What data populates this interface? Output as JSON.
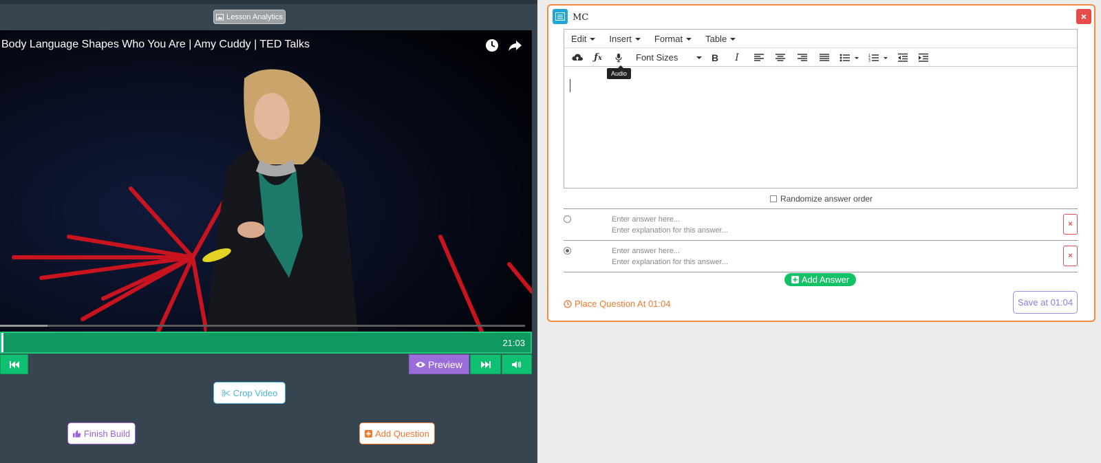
{
  "left": {
    "analytics_label": "Lesson Analytics",
    "video": {
      "title": "Body Language Shapes Who You Are | Amy Cuddy | TED Talks",
      "progress_loaded_fraction": 0.09
    },
    "timeline": {
      "time": "21:03"
    },
    "controls": {
      "preview_label": "Preview"
    },
    "crop_label": "Crop Video",
    "finish_label": "Finish Build",
    "add_question_label": "Add Question"
  },
  "panel": {
    "title": "MC",
    "close_label": "×",
    "menu": [
      "Edit",
      "Insert",
      "Format",
      "Table"
    ],
    "font_sizes_label": "Font Sizes",
    "tooltip": "Audio",
    "randomize_label": "Randomize answer order",
    "answers": [
      {
        "placeholder": "Enter answer here...",
        "explanation_placeholder": "Enter explanation for this answer...",
        "selected": false,
        "delete": "×"
      },
      {
        "placeholder": "Enter answer here...",
        "explanation_placeholder": "Enter explanation for this answer...",
        "selected": true,
        "delete": "×"
      }
    ],
    "add_answer_label": "Add Answer",
    "place_label": "Place Question At 01:04",
    "save_label": "Save at 01:04"
  },
  "colors": {
    "left_bg": "#36454f",
    "timeline": "#0f9960",
    "control_green": "#0fbf72",
    "preview_purple": "#9a6dd9",
    "panel_border": "#f58a3c",
    "add_answer": "#13c266",
    "danger": "#e54b4b"
  }
}
